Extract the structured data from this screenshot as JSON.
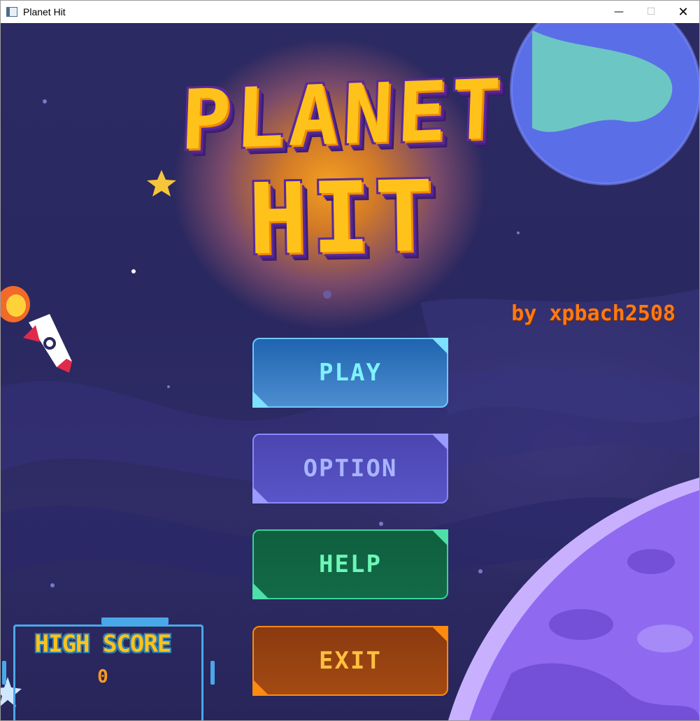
{
  "window": {
    "title": "Planet Hit",
    "min": "—",
    "max": "☐",
    "close": "✕"
  },
  "game": {
    "title_line1": "PLANET",
    "title_line2": "HIT",
    "author": "by xpbach2508",
    "menu": {
      "play": "PLAY",
      "option": "OPTION",
      "help": "HELP",
      "exit": "EXIT"
    },
    "high_score": {
      "label": "HIGH SCORE",
      "value": "0"
    }
  },
  "colors": {
    "title": "#ffc21a",
    "author": "#ff7a10",
    "play": "#7ef2ff",
    "option": "#a8b4ff",
    "help": "#6cf7b6",
    "exit": "#ffc040"
  },
  "icons": [
    "app-icon",
    "star-icon",
    "rocket-icon",
    "planet-icon"
  ]
}
